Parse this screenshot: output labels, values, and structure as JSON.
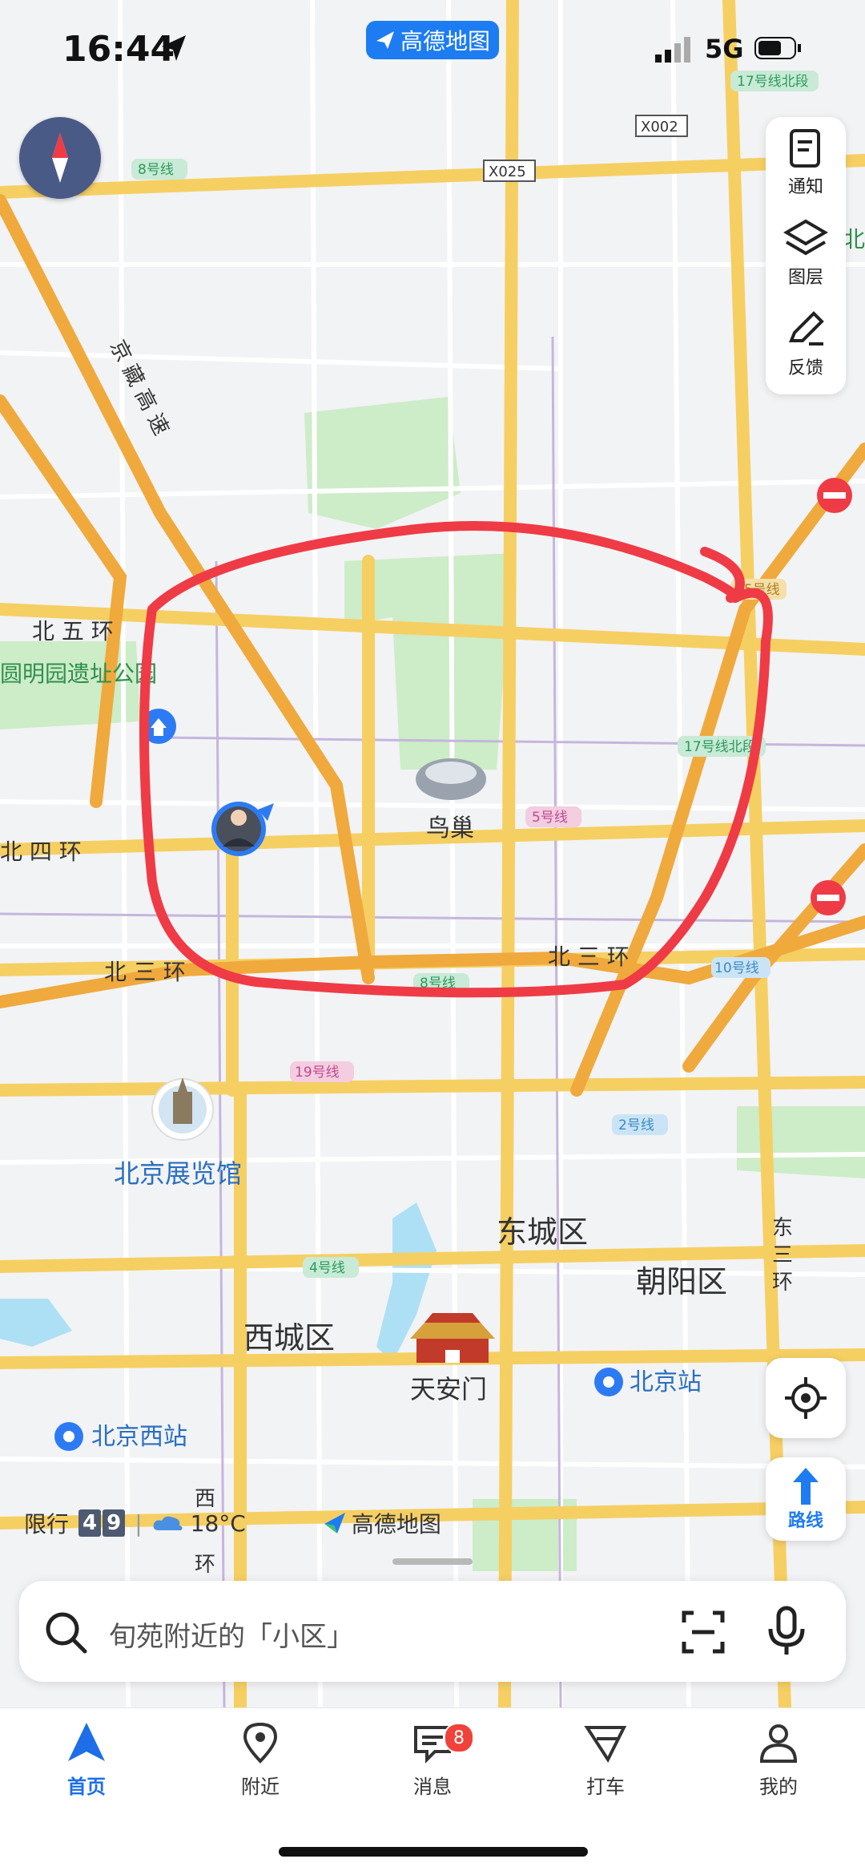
{
  "status_bar": {
    "time": "16:44",
    "app_name": "高德地图",
    "network": "5G"
  },
  "map": {
    "road_labels": [
      "京藏高速",
      "北五环",
      "北四环",
      "北三环",
      "北三环",
      "东三环",
      "西二环",
      "X025",
      "X002"
    ],
    "line_badges": [
      "8号线",
      "17号线北段",
      "17号线北段",
      "5号线",
      "8号线",
      "10号线",
      "19号线",
      "2号线",
      "4号线",
      "15号线"
    ],
    "places": {
      "yuanmingyuan": "圆明园遗址公园",
      "niaochao": "鸟巢",
      "exhibition": "北京展览馆",
      "dongcheng": "东城区",
      "chaoyang": "朝阳区",
      "xicheng": "西城区",
      "tiananmen": "天安门",
      "bjstation": "北京站",
      "bjwest": "北京西站",
      "bei": "北"
    }
  },
  "right_panel": {
    "notify_label": "通知",
    "layers_label": "图层",
    "feedback_label": "反馈"
  },
  "route_button": {
    "label": "路线"
  },
  "info_strip": {
    "restriction_label": "限行",
    "plate_digits": [
      "4",
      "9"
    ],
    "temperature": "18°C",
    "brand": "高德地图"
  },
  "search": {
    "placeholder": "旬苑附近的「小区」"
  },
  "tabs": [
    {
      "label": "首页"
    },
    {
      "label": "附近"
    },
    {
      "label": "消息",
      "badge": "8"
    },
    {
      "label": "打车"
    },
    {
      "label": "我的"
    }
  ],
  "colors": {
    "accent": "#1d6ee8",
    "annotation": "#ef3b45",
    "badge": "#f0423a"
  }
}
